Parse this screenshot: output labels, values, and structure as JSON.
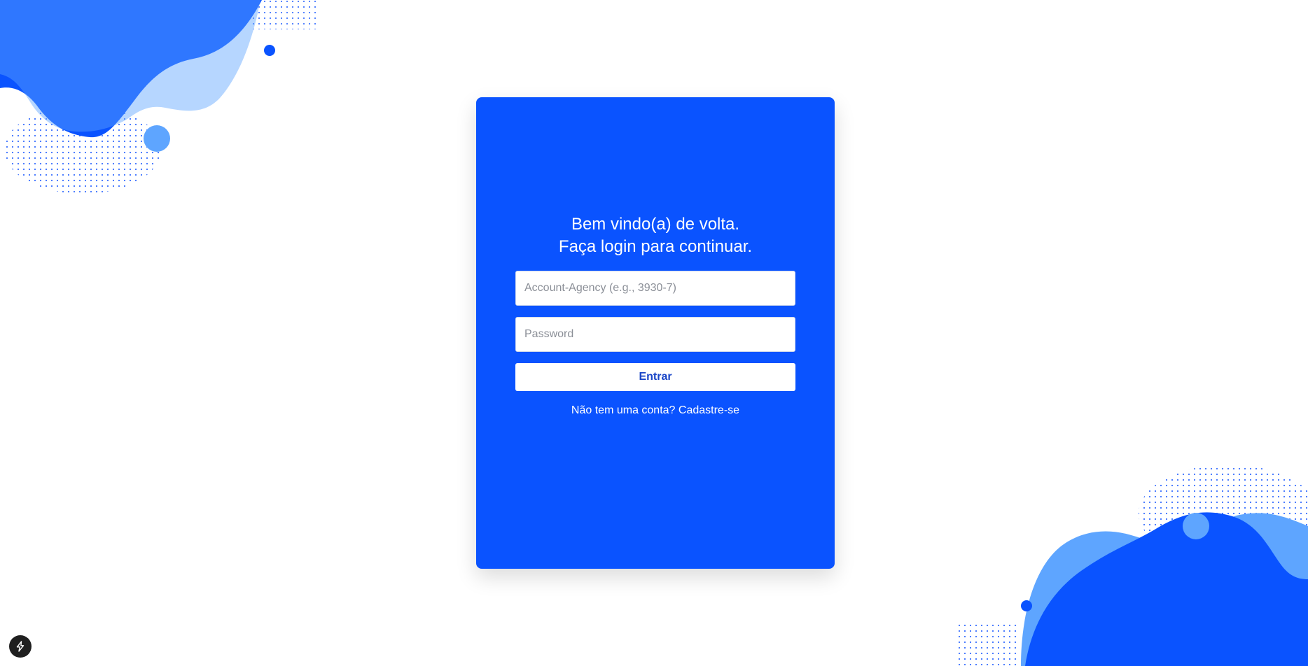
{
  "login": {
    "heading_line1": "Bem vindo(a) de volta.",
    "heading_line2": "Faça login para continuar.",
    "account_field": {
      "placeholder": "Account-Agency (e.g., 3930-7)",
      "value": ""
    },
    "password_field": {
      "placeholder": "Password",
      "value": ""
    },
    "submit_label": "Entrar",
    "signup_prompt": "Não tem uma conta?",
    "signup_link": "Cadastre-se"
  },
  "icons": {
    "dev_badge": "lightning-icon"
  },
  "colors": {
    "card_blue": "#0a53ff",
    "light_blue": "#5ea5ff",
    "button_text": "#1945c7",
    "badge_dark": "#1f1f1f"
  }
}
